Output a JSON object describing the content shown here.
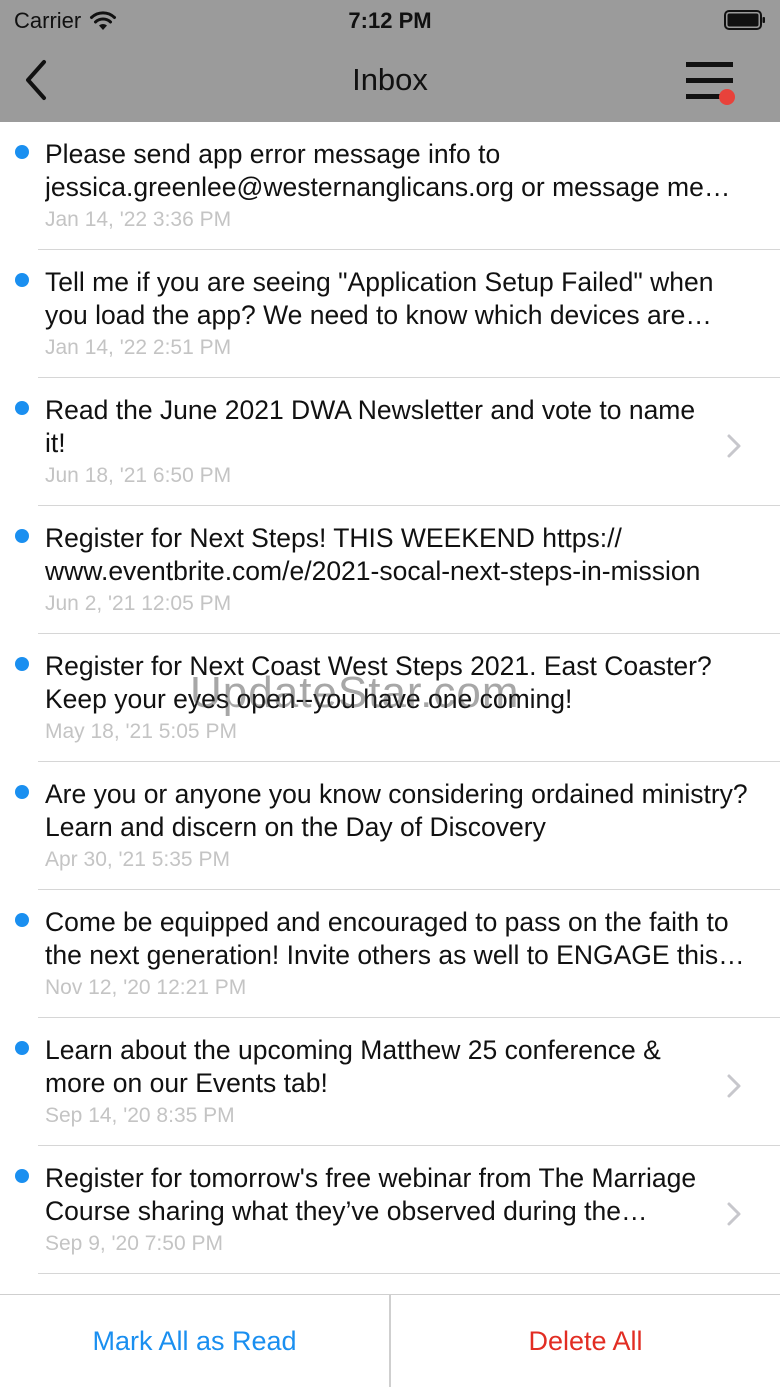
{
  "status_bar": {
    "carrier": "Carrier",
    "time": "7:12 PM",
    "wifi_icon": "wifi-icon",
    "battery_icon": "battery-icon"
  },
  "nav": {
    "title": "Inbox",
    "back_icon": "chevron-left-icon",
    "menu_icon": "hamburger-menu-icon",
    "menu_badge_color": "#e8423b"
  },
  "colors": {
    "bar_gray": "#9b9b9b",
    "unread_dot": "#1a8ff0",
    "date_gray": "#c4c4c4",
    "action_blue": "#1a8ff0",
    "action_red": "#e22d23"
  },
  "messages": [
    {
      "text": "Please send app error message info to jessica.greenlee@westernanglicans.org or message me with any issues",
      "date": "Jan 14, '22 3:36 PM",
      "unread": true,
      "chevron": false
    },
    {
      "text": "Tell me if you are seeing \"Application Setup Failed\" when you load the app? We need to know which devices are affected",
      "date": "Jan 14, '22 2:51 PM",
      "unread": true,
      "chevron": false
    },
    {
      "text": "Read the June 2021 DWA Newsletter and vote to name it!",
      "date": "Jun 18, '21 6:50 PM",
      "unread": true,
      "chevron": true
    },
    {
      "text": "Register for Next Steps!  THIS WEEKEND https:// www.eventbrite.com/e/2021-socal-next-steps-in-mission",
      "date": "Jun 2, '21 12:05 PM",
      "unread": true,
      "chevron": false
    },
    {
      "text": "Register for Next Coast West Steps 2021. East Coaster? Keep your eyes open--you have one coming!",
      "date": "May 18, '21 5:05 PM",
      "unread": true,
      "chevron": false
    },
    {
      "text": "Are you or anyone you know considering ordained ministry? Learn and discern on the Day of Discovery",
      "date": "Apr 30, '21 5:35 PM",
      "unread": true,
      "chevron": false
    },
    {
      "text": "Come be equipped and encouraged to pass on the faith to the next generation! Invite others as well to ENGAGE this year",
      "date": "Nov 12, '20 12:21 PM",
      "unread": true,
      "chevron": false
    },
    {
      "text": "Learn about the upcoming Matthew 25 conference & more on our Events tab!",
      "date": "Sep 14, '20 8:35 PM",
      "unread": true,
      "chevron": true
    },
    {
      "text": "Register for tomorrow's free webinar from The Marriage Course sharing what they’ve observed during the pandemic",
      "date": "Sep 9, '20 7:50 PM",
      "unread": true,
      "chevron": true
    }
  ],
  "actions": {
    "mark_all": "Mark All as Read",
    "delete_all": "Delete All"
  },
  "watermark": "UpdateStar.com"
}
